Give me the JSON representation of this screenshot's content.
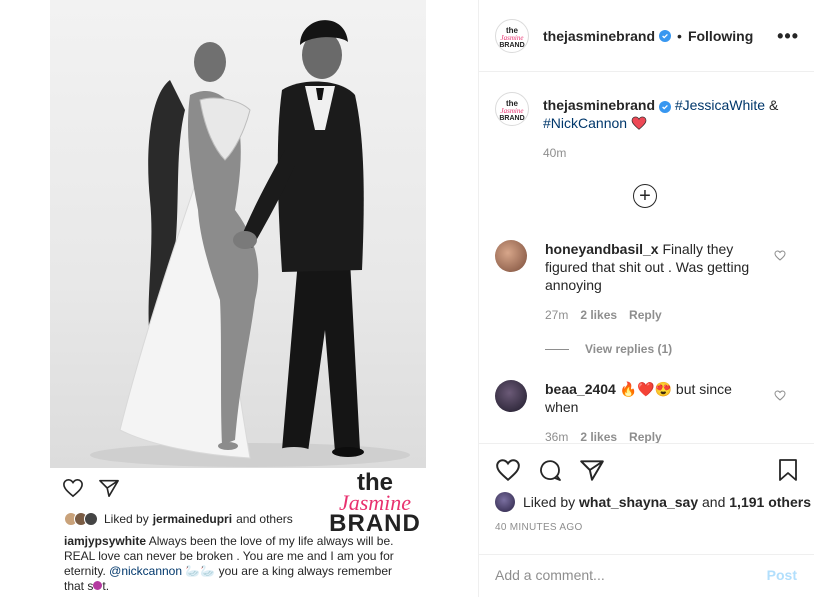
{
  "post_image": {
    "watermark": {
      "line1": "the",
      "line2": "Jasmine",
      "line3": "BRAND"
    },
    "inner_liked": {
      "prefix": "Liked by",
      "user": "jermainedupri",
      "suffix": "and others"
    },
    "inner_caption": {
      "user": "iamjypsywhite",
      "text1": "Always been the love of my life always will be. REAL love can never be broken . You are me and I am you for eternity.",
      "mention": "@nickcannon",
      "text2": "you are a king always remember that s",
      "text3": "t."
    }
  },
  "header": {
    "username": "thejasminebrand",
    "dot": "•",
    "follow_status": "Following",
    "more": "•••"
  },
  "caption": {
    "username": "thejasminebrand",
    "tag1": "#JessicaWhite",
    "amp": "&",
    "tag2": "#NickCannon",
    "time": "40m"
  },
  "comments": [
    {
      "username": "honeyandbasil_x",
      "text": "Finally they figured that shit out . Was getting annoying",
      "time": "27m",
      "likes": "2 likes",
      "reply": "Reply"
    },
    {
      "username": "beaa_2404",
      "text": "but since when",
      "time": "36m",
      "likes": "2 likes",
      "reply": "Reply"
    }
  ],
  "view_replies": "View replies (1)",
  "actions": {
    "liked_prefix": "Liked by",
    "liked_user": "what_shayna_say",
    "liked_and": "and",
    "liked_count": "1,191 others",
    "timestamp": "40 MINUTES AGO",
    "comment_placeholder": "Add a comment...",
    "post_label": "Post"
  },
  "colors": {
    "accent_blue": "#3897f0",
    "tag_blue": "#00376b",
    "brand_pink": "#e8316f",
    "heart_red": "#ed4956"
  }
}
